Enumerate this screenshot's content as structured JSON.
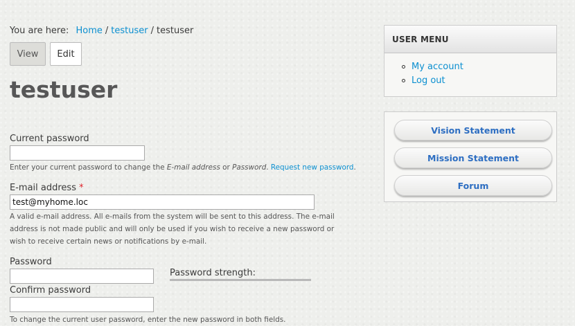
{
  "breadcrumb": {
    "label": "You are here:",
    "items": [
      "Home",
      "testuser",
      "testuser"
    ]
  },
  "tabs": {
    "view": "View",
    "edit": "Edit"
  },
  "page_title": "testuser",
  "form": {
    "current_password": {
      "label": "Current password",
      "value": "",
      "description_pre": "Enter your current password to change the ",
      "description_em1": "E-mail address",
      "description_mid": " or ",
      "description_em2": "Password",
      "description_post": ". ",
      "link": "Request new password",
      "link_after": "."
    },
    "email": {
      "label": "E-mail address",
      "required_mark": "*",
      "value": "test@myhome.loc",
      "description_lines": [
        "A valid e-mail address. All e-mails from the system will be sent to this address. The e-mail",
        "address is not made public and will only be used if you wish to receive a new password or",
        "wish to receive certain news or notifications by e-mail."
      ]
    },
    "password": {
      "label": "Password",
      "value": ""
    },
    "password_strength": {
      "label": "Password strength:"
    },
    "confirm_password": {
      "label": "Confirm password",
      "value": ""
    },
    "confirm_description": "To change the current user password, enter the new password in both fields."
  },
  "user_menu": {
    "title": "USER MENU",
    "items": [
      "My account",
      "Log out"
    ]
  },
  "links_block": {
    "items": [
      "Vision Statement",
      "Mission Statement",
      "Forum"
    ]
  },
  "colors": {
    "link": "#0b8fd0",
    "pill_text": "#2d6ec2",
    "required": "#e0242d"
  }
}
